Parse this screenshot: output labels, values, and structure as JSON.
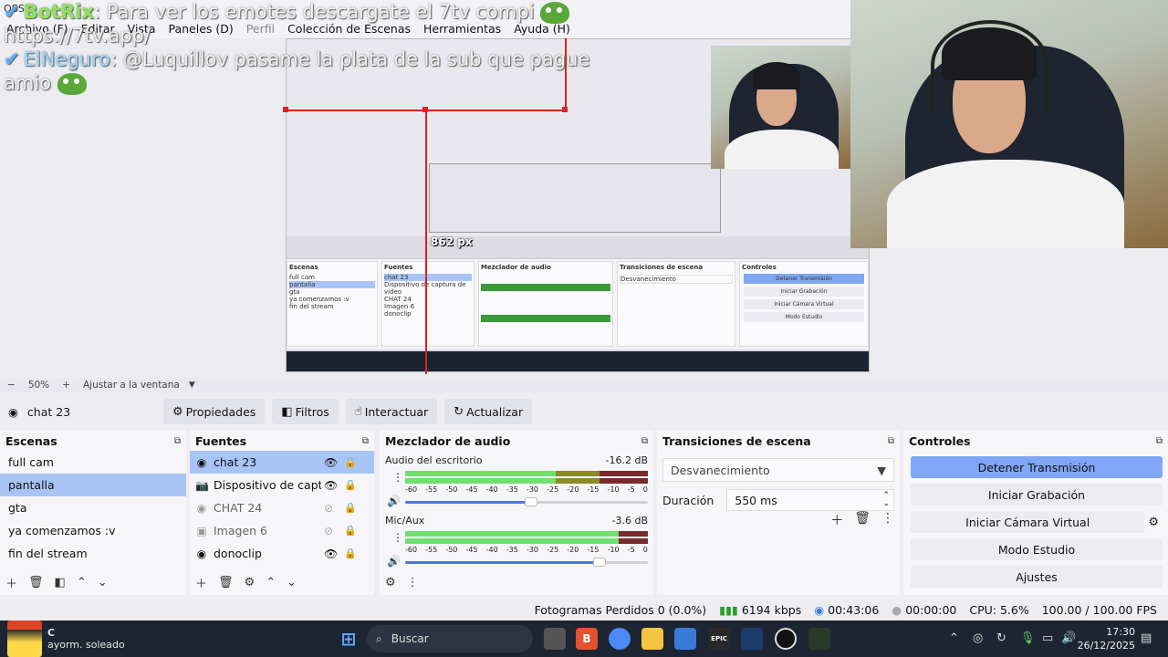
{
  "window": {
    "title": "OBS"
  },
  "menu": [
    "Archivo (F)",
    "Editar",
    "Vista",
    "Paneles (D)",
    "Perfil",
    "Colección de Escenas",
    "Herramientas",
    "Ayuda (H)"
  ],
  "chat": {
    "line1_user": "BotRix",
    "line1_text": "Para ver los emotes descargate el 7tv compi",
    "line2": "https://7tv.app/",
    "line3_user": "ElNeguro",
    "line3_text": ": @Luquillov pasame la plata de la sub que pague",
    "line4": "amio"
  },
  "preview": {
    "px_label_top": "862 px"
  },
  "zoom": {
    "minus": "−",
    "value": "50%",
    "plus": "+",
    "fit": "Ajustar a la ventana"
  },
  "source_toolbar": {
    "current_source": "chat 23",
    "properties": "Propiedades",
    "filters": "Filtros",
    "interact": "Interactuar",
    "refresh": "Actualizar"
  },
  "scenes": {
    "title": "Escenas",
    "items": [
      "full cam",
      "pantalla",
      "gta",
      "ya comenzamos :v",
      "fin del stream"
    ],
    "selected": 1
  },
  "sources": {
    "title": "Fuentes",
    "items": [
      {
        "label": "chat 23",
        "icon": "browser-icon",
        "visible": true
      },
      {
        "label": "Dispositivo de captura de video",
        "icon": "camera-icon",
        "visible": true
      },
      {
        "label": "CHAT 24",
        "icon": "browser-icon",
        "visible": false
      },
      {
        "label": "Imagen 6",
        "icon": "image-icon",
        "visible": false
      },
      {
        "label": "donoclip",
        "icon": "browser-icon",
        "visible": true
      }
    ]
  },
  "mixer": {
    "title": "Mezclador de audio",
    "tracks": [
      {
        "name": "Audio del escritorio",
        "db": "-16.2 dB",
        "level": 0.62,
        "volume": 0.52
      },
      {
        "name": "Mic/Aux",
        "db": "-3.6 dB",
        "level": 0.88,
        "volume": 0.8
      }
    ],
    "scale": [
      "-60",
      "-55",
      "-50",
      "-45",
      "-40",
      "-35",
      "-30",
      "-25",
      "-20",
      "-15",
      "-10",
      "-5",
      "0"
    ]
  },
  "transitions": {
    "title": "Transiciones de escena",
    "selected": "Desvanecimiento",
    "duration_label": "Duración",
    "duration_value": "550 ms"
  },
  "controls": {
    "title": "Controles",
    "buttons": [
      "Detener Transmisión",
      "Iniciar Grabación",
      "Iniciar Cámara Virtual",
      "Modo Estudio",
      "Ajustes"
    ]
  },
  "status": {
    "dropped": "Fotogramas Perdidos 0 (0.0%)",
    "bitrate": "6194 kbps",
    "stream_time": "00:43:06",
    "rec_time": "00:00:00",
    "cpu": "CPU: 5.6%",
    "fps": "100.00 / 100.00 FPS"
  },
  "taskbar": {
    "weather_temp": "C",
    "weather_desc": "ayorm. soleado",
    "search": "Buscar",
    "time": "17:30",
    "date": "26/12/2025"
  }
}
